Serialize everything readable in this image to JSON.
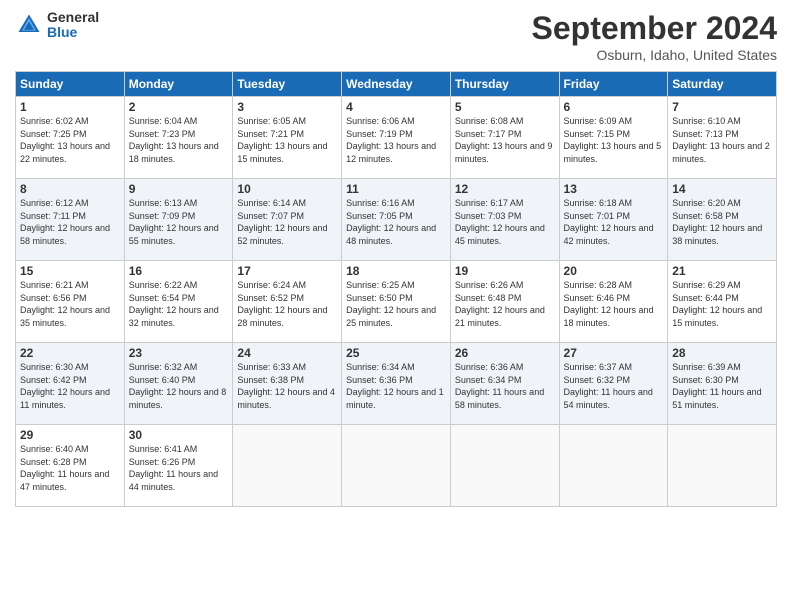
{
  "header": {
    "logo_general": "General",
    "logo_blue": "Blue",
    "month_title": "September 2024",
    "location": "Osburn, Idaho, United States"
  },
  "days_of_week": [
    "Sunday",
    "Monday",
    "Tuesday",
    "Wednesday",
    "Thursday",
    "Friday",
    "Saturday"
  ],
  "weeks": [
    [
      {
        "day": "1",
        "sunrise": "6:02 AM",
        "sunset": "7:25 PM",
        "daylight": "13 hours and 22 minutes."
      },
      {
        "day": "2",
        "sunrise": "6:04 AM",
        "sunset": "7:23 PM",
        "daylight": "13 hours and 18 minutes."
      },
      {
        "day": "3",
        "sunrise": "6:05 AM",
        "sunset": "7:21 PM",
        "daylight": "13 hours and 15 minutes."
      },
      {
        "day": "4",
        "sunrise": "6:06 AM",
        "sunset": "7:19 PM",
        "daylight": "13 hours and 12 minutes."
      },
      {
        "day": "5",
        "sunrise": "6:08 AM",
        "sunset": "7:17 PM",
        "daylight": "13 hours and 9 minutes."
      },
      {
        "day": "6",
        "sunrise": "6:09 AM",
        "sunset": "7:15 PM",
        "daylight": "13 hours and 5 minutes."
      },
      {
        "day": "7",
        "sunrise": "6:10 AM",
        "sunset": "7:13 PM",
        "daylight": "13 hours and 2 minutes."
      }
    ],
    [
      {
        "day": "8",
        "sunrise": "6:12 AM",
        "sunset": "7:11 PM",
        "daylight": "12 hours and 58 minutes."
      },
      {
        "day": "9",
        "sunrise": "6:13 AM",
        "sunset": "7:09 PM",
        "daylight": "12 hours and 55 minutes."
      },
      {
        "day": "10",
        "sunrise": "6:14 AM",
        "sunset": "7:07 PM",
        "daylight": "12 hours and 52 minutes."
      },
      {
        "day": "11",
        "sunrise": "6:16 AM",
        "sunset": "7:05 PM",
        "daylight": "12 hours and 48 minutes."
      },
      {
        "day": "12",
        "sunrise": "6:17 AM",
        "sunset": "7:03 PM",
        "daylight": "12 hours and 45 minutes."
      },
      {
        "day": "13",
        "sunrise": "6:18 AM",
        "sunset": "7:01 PM",
        "daylight": "12 hours and 42 minutes."
      },
      {
        "day": "14",
        "sunrise": "6:20 AM",
        "sunset": "6:58 PM",
        "daylight": "12 hours and 38 minutes."
      }
    ],
    [
      {
        "day": "15",
        "sunrise": "6:21 AM",
        "sunset": "6:56 PM",
        "daylight": "12 hours and 35 minutes."
      },
      {
        "day": "16",
        "sunrise": "6:22 AM",
        "sunset": "6:54 PM",
        "daylight": "12 hours and 32 minutes."
      },
      {
        "day": "17",
        "sunrise": "6:24 AM",
        "sunset": "6:52 PM",
        "daylight": "12 hours and 28 minutes."
      },
      {
        "day": "18",
        "sunrise": "6:25 AM",
        "sunset": "6:50 PM",
        "daylight": "12 hours and 25 minutes."
      },
      {
        "day": "19",
        "sunrise": "6:26 AM",
        "sunset": "6:48 PM",
        "daylight": "12 hours and 21 minutes."
      },
      {
        "day": "20",
        "sunrise": "6:28 AM",
        "sunset": "6:46 PM",
        "daylight": "12 hours and 18 minutes."
      },
      {
        "day": "21",
        "sunrise": "6:29 AM",
        "sunset": "6:44 PM",
        "daylight": "12 hours and 15 minutes."
      }
    ],
    [
      {
        "day": "22",
        "sunrise": "6:30 AM",
        "sunset": "6:42 PM",
        "daylight": "12 hours and 11 minutes."
      },
      {
        "day": "23",
        "sunrise": "6:32 AM",
        "sunset": "6:40 PM",
        "daylight": "12 hours and 8 minutes."
      },
      {
        "day": "24",
        "sunrise": "6:33 AM",
        "sunset": "6:38 PM",
        "daylight": "12 hours and 4 minutes."
      },
      {
        "day": "25",
        "sunrise": "6:34 AM",
        "sunset": "6:36 PM",
        "daylight": "12 hours and 1 minute."
      },
      {
        "day": "26",
        "sunrise": "6:36 AM",
        "sunset": "6:34 PM",
        "daylight": "11 hours and 58 minutes."
      },
      {
        "day": "27",
        "sunrise": "6:37 AM",
        "sunset": "6:32 PM",
        "daylight": "11 hours and 54 minutes."
      },
      {
        "day": "28",
        "sunrise": "6:39 AM",
        "sunset": "6:30 PM",
        "daylight": "11 hours and 51 minutes."
      }
    ],
    [
      {
        "day": "29",
        "sunrise": "6:40 AM",
        "sunset": "6:28 PM",
        "daylight": "11 hours and 47 minutes."
      },
      {
        "day": "30",
        "sunrise": "6:41 AM",
        "sunset": "6:26 PM",
        "daylight": "11 hours and 44 minutes."
      },
      null,
      null,
      null,
      null,
      null
    ]
  ]
}
